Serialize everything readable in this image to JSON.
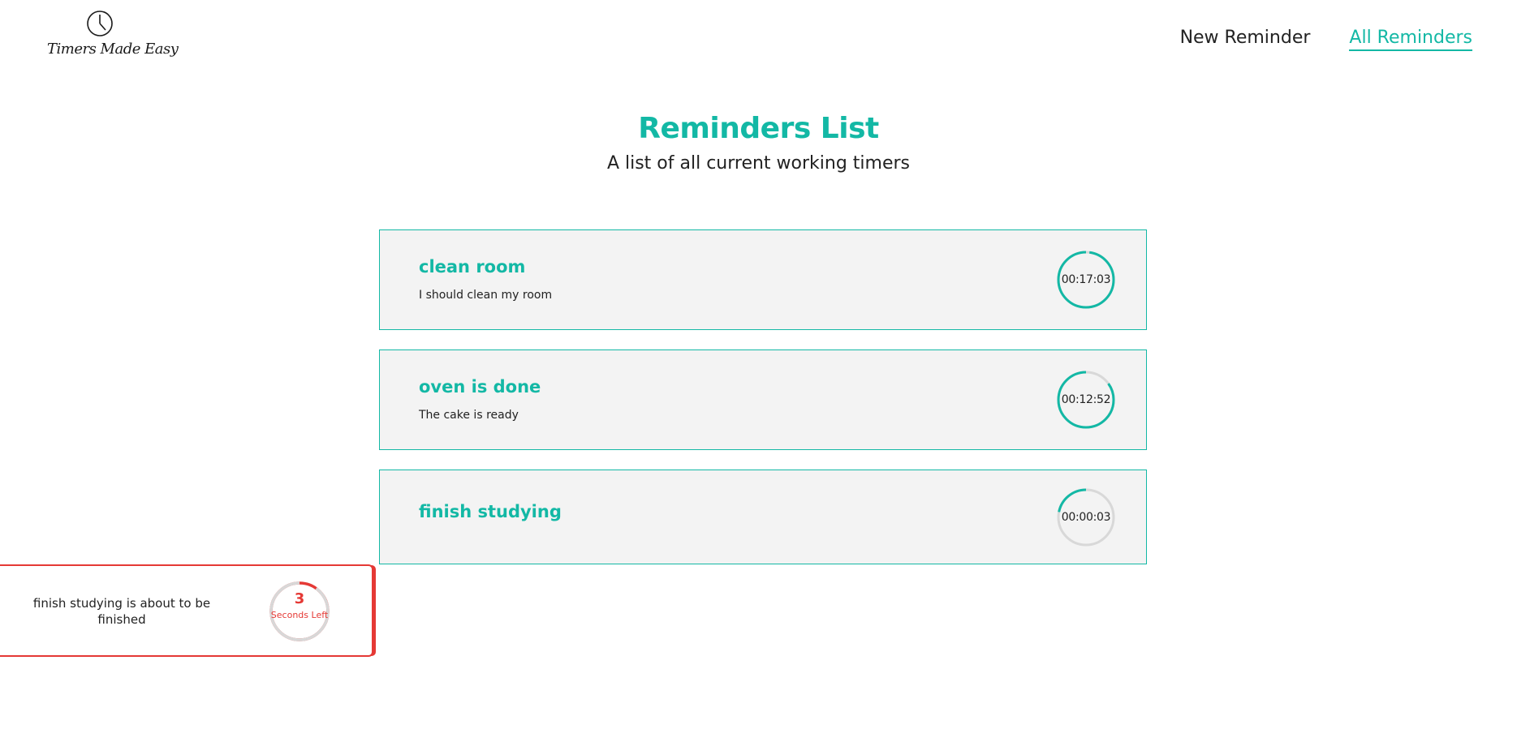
{
  "brand": {
    "logo_text": "Timers Made Easy",
    "icon": "clock-icon"
  },
  "nav": {
    "new_reminder": "New Reminder",
    "all_reminders": "All Reminders",
    "active": "all_reminders"
  },
  "page": {
    "title": "Reminders List",
    "subtitle": "A list of all current working timers"
  },
  "reminders": [
    {
      "title": "clean room",
      "description": "I should clean my room",
      "time_left": "00:17:03",
      "progress": 0.02
    },
    {
      "title": "oven is done",
      "description": "The cake is ready",
      "time_left": "00:12:52",
      "progress": 0.15
    },
    {
      "title": "finish studying",
      "description": "",
      "time_left": "00:00:03",
      "progress": 0.78
    }
  ],
  "toast": {
    "message": "finish studying is about to be finished",
    "count": "3",
    "unit": "Seconds Left",
    "progress": 0.1
  },
  "colors": {
    "accent": "#13b8a5",
    "alert": "#e53935",
    "card_bg": "#f3f3f3",
    "ring_track": "#d8d8d8"
  }
}
